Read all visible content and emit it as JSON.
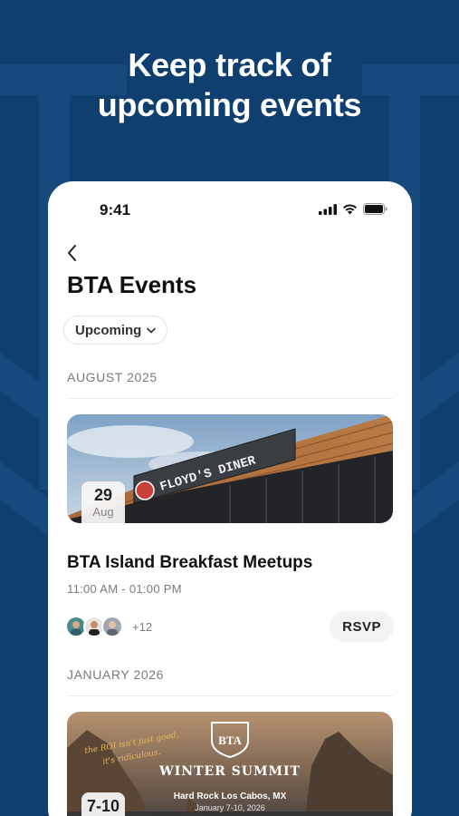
{
  "headline": {
    "line1": "Keep track of",
    "line2": "upcoming events"
  },
  "status_bar": {
    "time": "9:41",
    "icons": [
      "signal-icon",
      "wifi-icon",
      "battery-icon"
    ]
  },
  "nav": {
    "back_icon": "chevron-left-icon"
  },
  "page": {
    "title": "BTA Events"
  },
  "filter": {
    "selected": "Upcoming",
    "icon": "chevron-down-icon"
  },
  "sections": [
    {
      "header": "AUGUST 2025",
      "event": {
        "image_sign": "FLOYD'S DINER",
        "date_day": "29",
        "date_month": "Aug",
        "title": "BTA Island Breakfast Meetups",
        "time": "11:00 AM - 01:00 PM",
        "attendees_more": "+12",
        "rsvp_label": "RSVP"
      }
    },
    {
      "header": "JANUARY 2026",
      "event": {
        "image_logo": "BTA",
        "image_handwritten_1": "the ROI isn't just good,",
        "image_handwritten_2": "it's ridiculous.",
        "image_title": "WINTER SUMMIT",
        "image_location": "Hard Rock Los Cabos, MX",
        "image_dates": "January 7-10, 2026",
        "date_day": "7-10"
      }
    }
  ],
  "colors": {
    "background": "#0f3f6e",
    "card": "#ffffff",
    "rsvp_bg": "#f3f3f5"
  }
}
